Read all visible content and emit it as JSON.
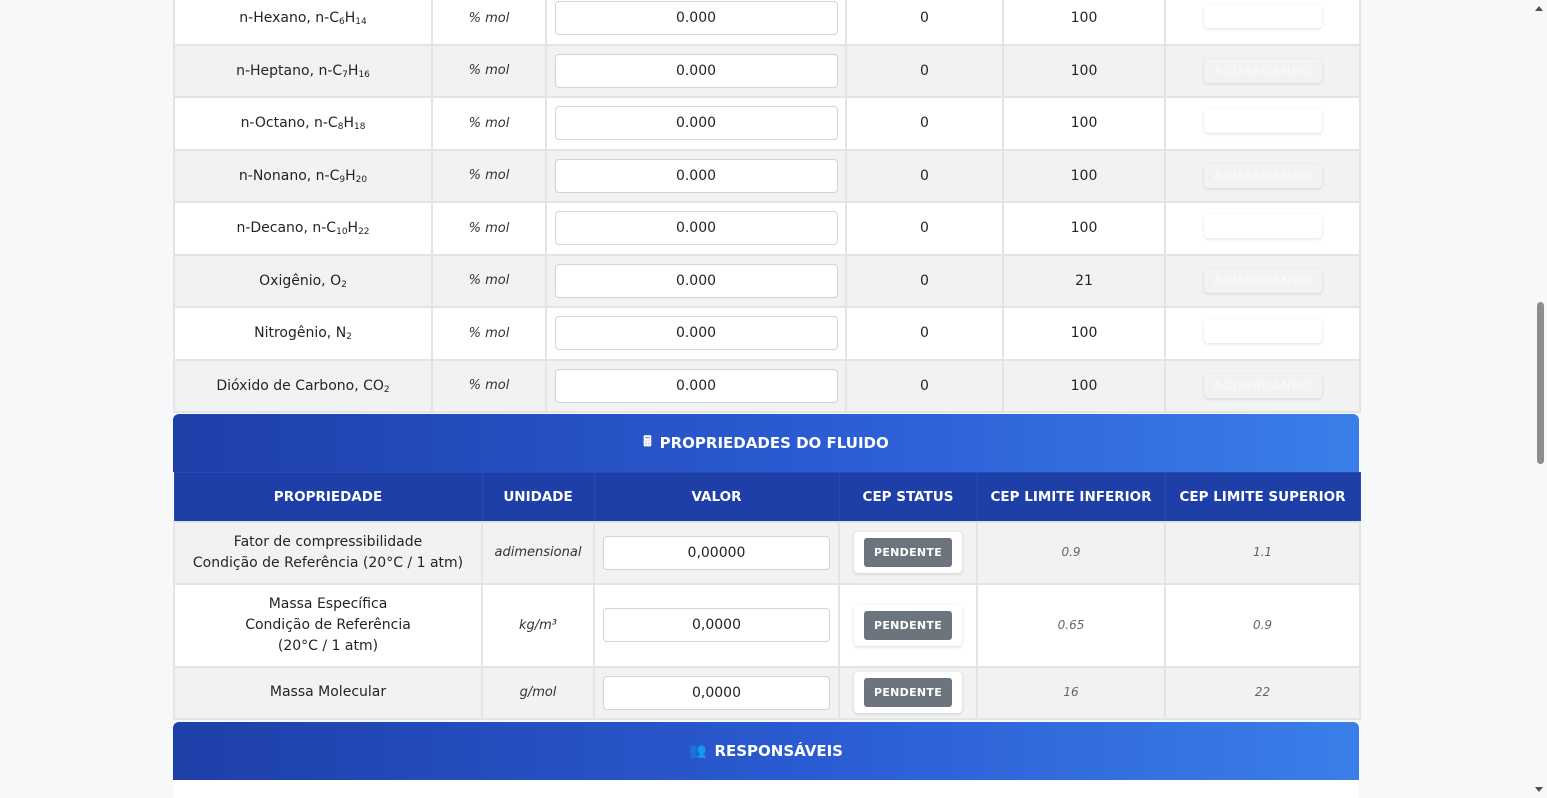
{
  "components": {
    "rows": [
      {
        "name": "n-Hexano, n-C",
        "sub1": "6",
        "mid": "H",
        "sub2": "14",
        "unit": "% mol",
        "value": "0.000",
        "min": "0",
        "max": "100",
        "status": ""
      },
      {
        "name": "n-Heptano, n-C",
        "sub1": "7",
        "mid": "H",
        "sub2": "16",
        "unit": "% mol",
        "value": "0.000",
        "min": "0",
        "max": "100",
        "status": "AGUARDANDO"
      },
      {
        "name": "n-Octano, n-C",
        "sub1": "8",
        "mid": "H",
        "sub2": "18",
        "unit": "% mol",
        "value": "0.000",
        "min": "0",
        "max": "100",
        "status": ""
      },
      {
        "name": "n-Nonano, n-C",
        "sub1": "9",
        "mid": "H",
        "sub2": "20",
        "unit": "% mol",
        "value": "0.000",
        "min": "0",
        "max": "100",
        "status": "AGUARDANDO"
      },
      {
        "name": "n-Decano, n-C",
        "sub1": "10",
        "mid": "H",
        "sub2": "22",
        "unit": "% mol",
        "value": "0.000",
        "min": "0",
        "max": "100",
        "status": ""
      },
      {
        "name": "Oxigênio, O",
        "sub1": "2",
        "mid": "",
        "sub2": "",
        "unit": "% mol",
        "value": "0.000",
        "min": "0",
        "max": "21",
        "status": "AGUARDANDO"
      },
      {
        "name": "Nitrogênio, N",
        "sub1": "2",
        "mid": "",
        "sub2": "",
        "unit": "% mol",
        "value": "0.000",
        "min": "0",
        "max": "100",
        "status": ""
      },
      {
        "name": "Dióxido de Carbono, CO",
        "sub1": "2",
        "mid": "",
        "sub2": "",
        "unit": "% mol",
        "value": "0.000",
        "min": "0",
        "max": "100",
        "status": "AGUARDANDO"
      }
    ]
  },
  "fluid_section": {
    "icon": "calculator-icon",
    "title": "PROPRIEDADES DO FLUIDO",
    "headers": [
      "PROPRIEDADE",
      "UNIDADE",
      "VALOR",
      "CEP STATUS",
      "CEP LIMITE INFERIOR",
      "CEP LIMITE SUPERIOR"
    ],
    "rows": [
      {
        "lines": [
          "Fator de compressibilidade",
          "Condição de Referência (20°C / 1 atm)"
        ],
        "unit": "adimensional",
        "value": "0,00000",
        "status": "PENDENTE",
        "lower": "0.9",
        "upper": "1.1"
      },
      {
        "lines": [
          "Massa Específica",
          "Condição de Referência",
          "(20°C / 1 atm)"
        ],
        "unit": "kg/m³",
        "value": "0,0000",
        "status": "PENDENTE",
        "lower": "0.65",
        "upper": "0.9"
      },
      {
        "lines": [
          "Massa Molecular"
        ],
        "unit": "g/mol",
        "value": "0,0000",
        "status": "PENDENTE",
        "lower": "16",
        "upper": "22"
      }
    ]
  },
  "resp_section": {
    "icon": "users-icon",
    "title": "RESPONSÁVEIS"
  },
  "colors": {
    "header_gradient_start": "#1e3fa8",
    "header_gradient_end": "#3a7fe9",
    "badge_pending": "#6c757d"
  }
}
